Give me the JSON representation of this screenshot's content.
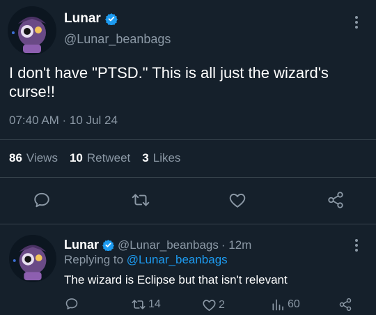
{
  "main_tweet": {
    "author_name": "Lunar",
    "handle": "@Lunar_beanbags",
    "text": "I don't have \"PTSD.\" This is all just the wizard's curse!!",
    "timestamp": "07:40 AM · 10 Jul 24",
    "stats": {
      "views_count": "86",
      "views_label": "Views",
      "retweets_count": "10",
      "retweets_label": "Retweet",
      "likes_count": "3",
      "likes_label": "Likes"
    },
    "actions": [
      "reply-icon",
      "retweet-icon",
      "like-icon",
      "share-icon"
    ]
  },
  "reply_tweet": {
    "author_name": "Lunar",
    "handle": "@Lunar_beanbags",
    "time_ago": "· 12m",
    "replying_prefix": "Replying to",
    "replying_handle": "@Lunar_beanbags",
    "text": "The wizard is Eclipse but that isn't relevant",
    "counts": {
      "retweets": "14",
      "likes": "2",
      "views": "60"
    }
  },
  "colors": {
    "background": "#15202b",
    "text": "#ffffff",
    "muted": "#8b98a5",
    "accent": "#1d9bf0",
    "divider": "#38444d"
  }
}
